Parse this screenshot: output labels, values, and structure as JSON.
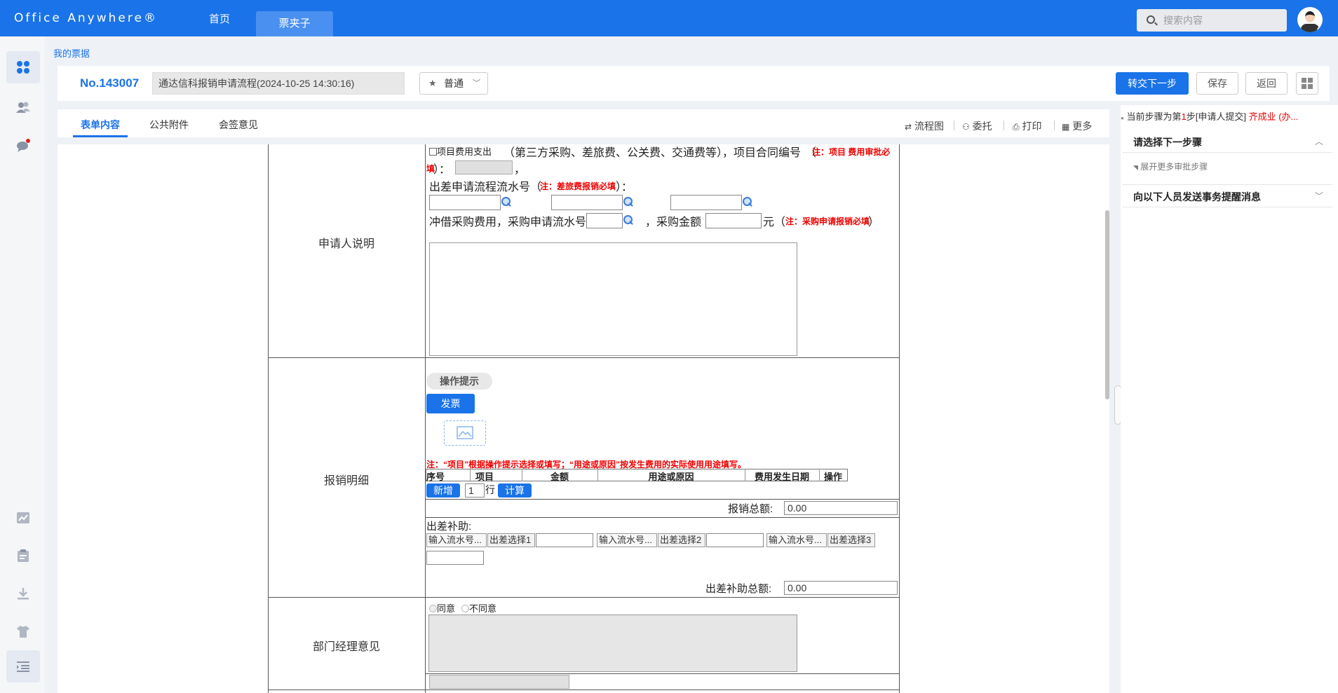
{
  "topbar": {
    "logo": "Office Anywhere®",
    "nav": [
      "首页",
      "票夹子"
    ],
    "search_placeholder": "搜索内容"
  },
  "breadcrumb": "我的票据",
  "header": {
    "number": "No.143007",
    "flow_name": "通达信科报销申请流程(2024-10-25 14:30:16)",
    "level": "普通",
    "buttons": {
      "next": "转交下一步",
      "save": "保存",
      "back": "返回"
    }
  },
  "tabs": [
    "表单内容",
    "公共附件",
    "会签意见"
  ],
  "tools": [
    "流程图",
    "委托",
    "打印",
    "更多"
  ],
  "form": {
    "applicant_label": "申请人说明",
    "project_checkbox": "项目费用支出",
    "project_text": "（第三方采购、差旅费、公关费、交通费等），项目合同编号",
    "project_note_open": "（",
    "project_note": "注：项目 费用审批必",
    "project_note_cont": "填",
    "project_note_close": "）：",
    "comma": "，",
    "trip_label": "出差申请流程流水号（",
    "trip_note": "注：差旅费报销必填",
    "trip_close": "）：",
    "borrow_text": "冲借采购费用，采购申请流水号",
    "amount_text": "，采购金额",
    "yuan": "元（",
    "purchase_note": "注：采购申请报销必填",
    "purchase_close": "）",
    "detail_label": "报销明细",
    "op_hint": "操作提示",
    "invoice_btn": "发票",
    "detail_note": "注：“项目”根据操作提示选择或填写；“用途或原因”按发生费用的实际使用用途填写。",
    "table_headers": [
      "序号",
      "项目",
      "金额",
      "用途或原因",
      "费用发生日期",
      "操作"
    ],
    "add_btn": "新增",
    "rows_value": "1",
    "rows_unit": "行",
    "calc_btn": "计算",
    "total_label": "报销总额:",
    "total_value": "0.00",
    "allowance_label": "出差补助:",
    "serial_placeholder": "输入流水号...",
    "trip_select_1": "出差选择1",
    "trip_select_2": "出差选择2",
    "trip_select_3": "出差选择3",
    "allowance_total_label": "出差补助总额:",
    "allowance_total_value": "0.00",
    "manager_label": "部门经理意见",
    "agree": "同意",
    "disagree": "不同意"
  },
  "right_panel": {
    "step_prefix": "当前步骤为第",
    "step_num": "1",
    "step_mid": "步[申请人提交]",
    "step_user": "齐成业 (办...",
    "next_step_title": "请选择下一步骤",
    "expand_more": "展开更多审批步骤",
    "notify_title": "向以下人员发送事务提醒消息"
  }
}
